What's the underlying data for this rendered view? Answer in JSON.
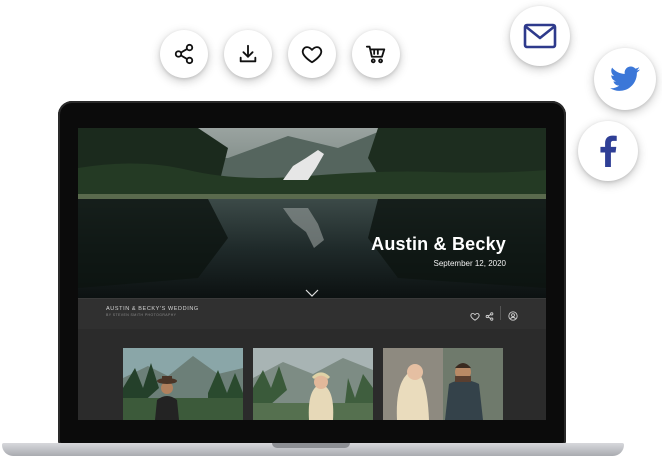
{
  "share_actions": [
    {
      "name": "share",
      "icon": "share-icon"
    },
    {
      "name": "download",
      "icon": "download-icon"
    },
    {
      "name": "favorite",
      "icon": "heart-icon"
    },
    {
      "name": "cart",
      "icon": "cart-icon"
    }
  ],
  "social": [
    {
      "name": "email",
      "icon": "mail-icon",
      "color": "#2e3a8c"
    },
    {
      "name": "twitter",
      "icon": "twitter-icon",
      "color": "#3b77d8"
    },
    {
      "name": "facebook",
      "icon": "facebook-icon",
      "color": "#2f3f96"
    }
  ],
  "gallery": {
    "hero_title": "Austin & Becky",
    "hero_date": "September 12, 2020",
    "album_title": "AUSTIN & BECKY'S WEDDING",
    "album_subtitle": "BY STEVEN SMITH PHOTOGRAPHY",
    "thumbnails": [
      "groom-portrait",
      "bride-portrait",
      "couple-portrait"
    ]
  },
  "colors": {
    "icon_dark": "#111111",
    "screen_bg": "#2b2b2b",
    "infobar_bg": "#303030"
  }
}
